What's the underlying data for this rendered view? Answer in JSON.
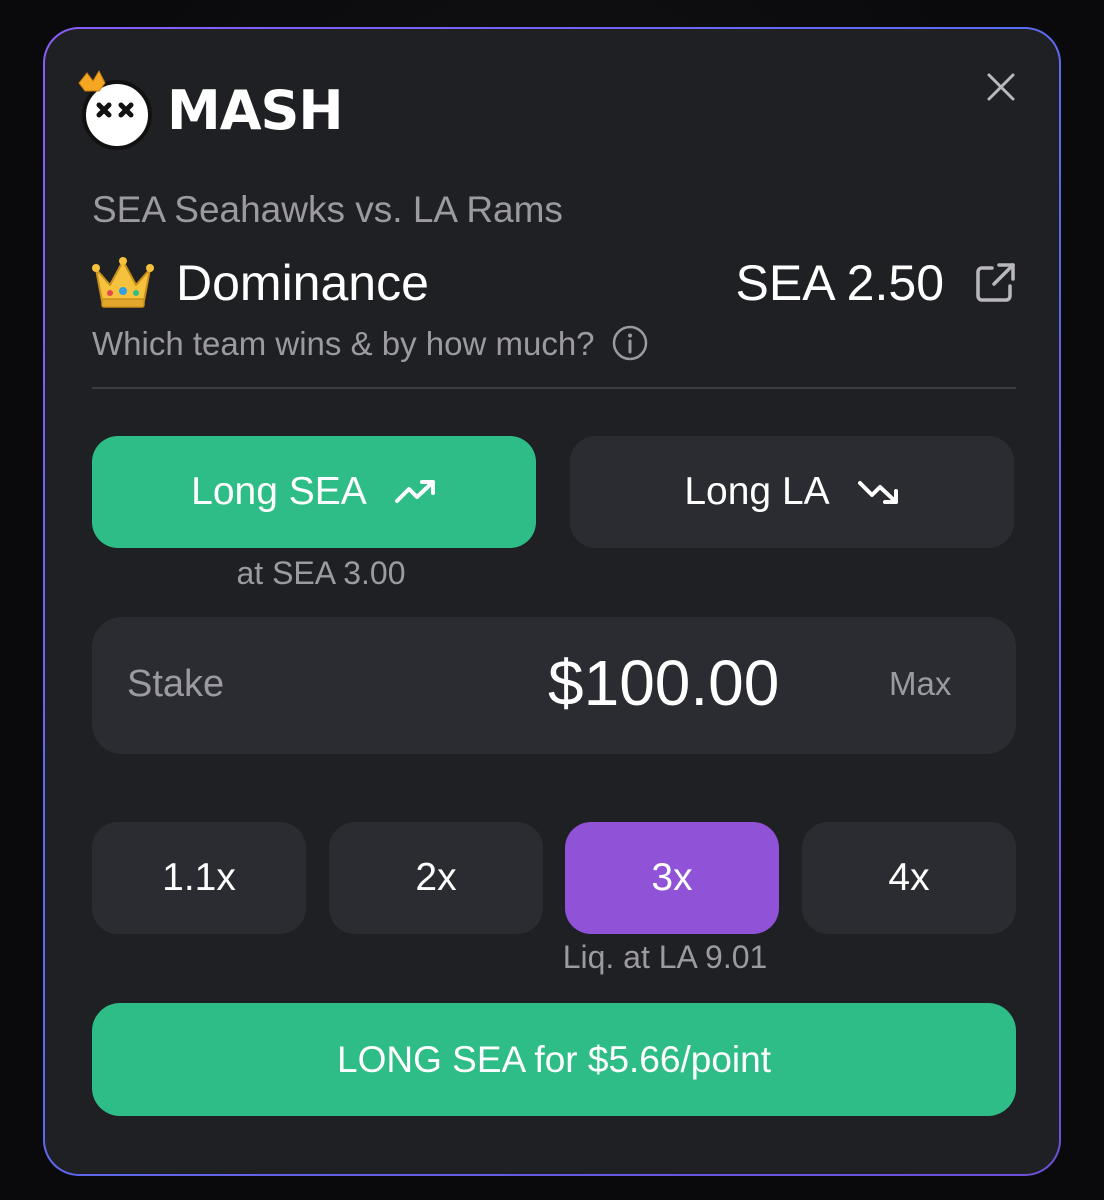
{
  "brand": {
    "name": "MASH"
  },
  "header": {
    "close_icon": "close-icon"
  },
  "market": {
    "matchup": "SEA Seahawks vs. LA Rams",
    "emoji": "crown-icon",
    "name": "Dominance",
    "line": "SEA 2.50",
    "question": "Which team wins & by how much?"
  },
  "sides": {
    "long_sea": {
      "label": "Long SEA",
      "icon": "trend-up-icon",
      "selected": true
    },
    "long_la": {
      "label": "Long LA",
      "icon": "trend-down-icon",
      "selected": false
    },
    "price_note": "at SEA 3.00"
  },
  "stake": {
    "label": "Stake",
    "amount": "$100.00",
    "max_label": "Max"
  },
  "leverage": {
    "options": [
      "1.1x",
      "2x",
      "3x",
      "4x"
    ],
    "selected": "3x",
    "liquidation_note": "Liq. at LA 9.01"
  },
  "submit": {
    "label": "LONG SEA for $5.66/point"
  },
  "colors": {
    "green": "#2fbd87",
    "purple": "#9052d6",
    "card_bg": "#1f2024",
    "control_bg": "#2b2c31",
    "muted_text": "#9a9aa0"
  }
}
